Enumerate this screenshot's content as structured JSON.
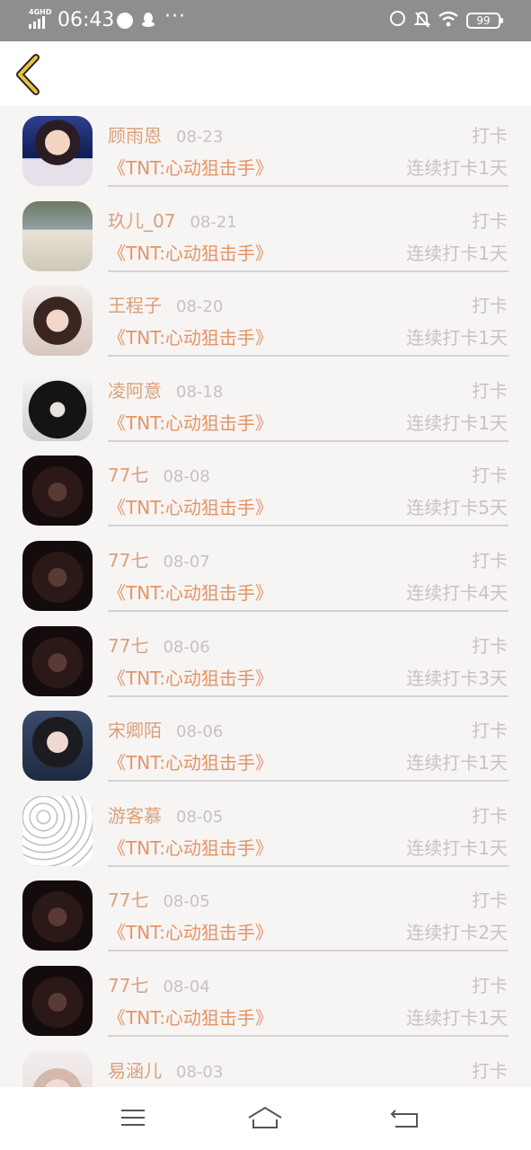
{
  "status_bar": {
    "network": "4GHD",
    "time": "06:43",
    "more": "···",
    "battery": "99"
  },
  "header": {
    "back_icon": "chevron-left-icon",
    "accent": "#c9a42a"
  },
  "colors": {
    "name": "#d9a17a",
    "title": "#e29566",
    "muted": "#c8c2c2",
    "background": "#f7f4f4"
  },
  "records": [
    {
      "name": "顾雨恩",
      "date": "08-23",
      "title": "《TNT:心动狙击手》",
      "label": "打卡",
      "streak": "连续打卡1天",
      "avatar": "a"
    },
    {
      "name": "玖儿_07",
      "date": "08-21",
      "title": "《TNT:心动狙击手》",
      "label": "打卡",
      "streak": "连续打卡1天",
      "avatar": "b"
    },
    {
      "name": "王程子",
      "date": "08-20",
      "title": "《TNT:心动狙击手》",
      "label": "打卡",
      "streak": "连续打卡1天",
      "avatar": "c"
    },
    {
      "name": "凌阿意",
      "date": "08-18",
      "title": "《TNT:心动狙击手》",
      "label": "打卡",
      "streak": "连续打卡1天",
      "avatar": "d"
    },
    {
      "name": "77七",
      "date": "08-08",
      "title": "《TNT:心动狙击手》",
      "label": "打卡",
      "streak": "连续打卡5天",
      "avatar": "e"
    },
    {
      "name": "77七",
      "date": "08-07",
      "title": "《TNT:心动狙击手》",
      "label": "打卡",
      "streak": "连续打卡4天",
      "avatar": "e"
    },
    {
      "name": "77七",
      "date": "08-06",
      "title": "《TNT:心动狙击手》",
      "label": "打卡",
      "streak": "连续打卡3天",
      "avatar": "e"
    },
    {
      "name": "宋卿陌",
      "date": "08-06",
      "title": "《TNT:心动狙击手》",
      "label": "打卡",
      "streak": "连续打卡1天",
      "avatar": "f"
    },
    {
      "name": "游客慕",
      "date": "08-05",
      "title": "《TNT:心动狙击手》",
      "label": "打卡",
      "streak": "连续打卡1天",
      "avatar": "g"
    },
    {
      "name": "77七",
      "date": "08-05",
      "title": "《TNT:心动狙击手》",
      "label": "打卡",
      "streak": "连续打卡2天",
      "avatar": "e"
    },
    {
      "name": "77七",
      "date": "08-04",
      "title": "《TNT:心动狙击手》",
      "label": "打卡",
      "streak": "连续打卡1天",
      "avatar": "e"
    },
    {
      "name": "易涵儿",
      "date": "08-03",
      "title": "",
      "label": "打卡",
      "streak": "",
      "avatar": "h"
    }
  ],
  "nav_bar": {
    "menu_icon": "menu-icon",
    "home_icon": "home-icon",
    "back_icon": "return-icon"
  }
}
